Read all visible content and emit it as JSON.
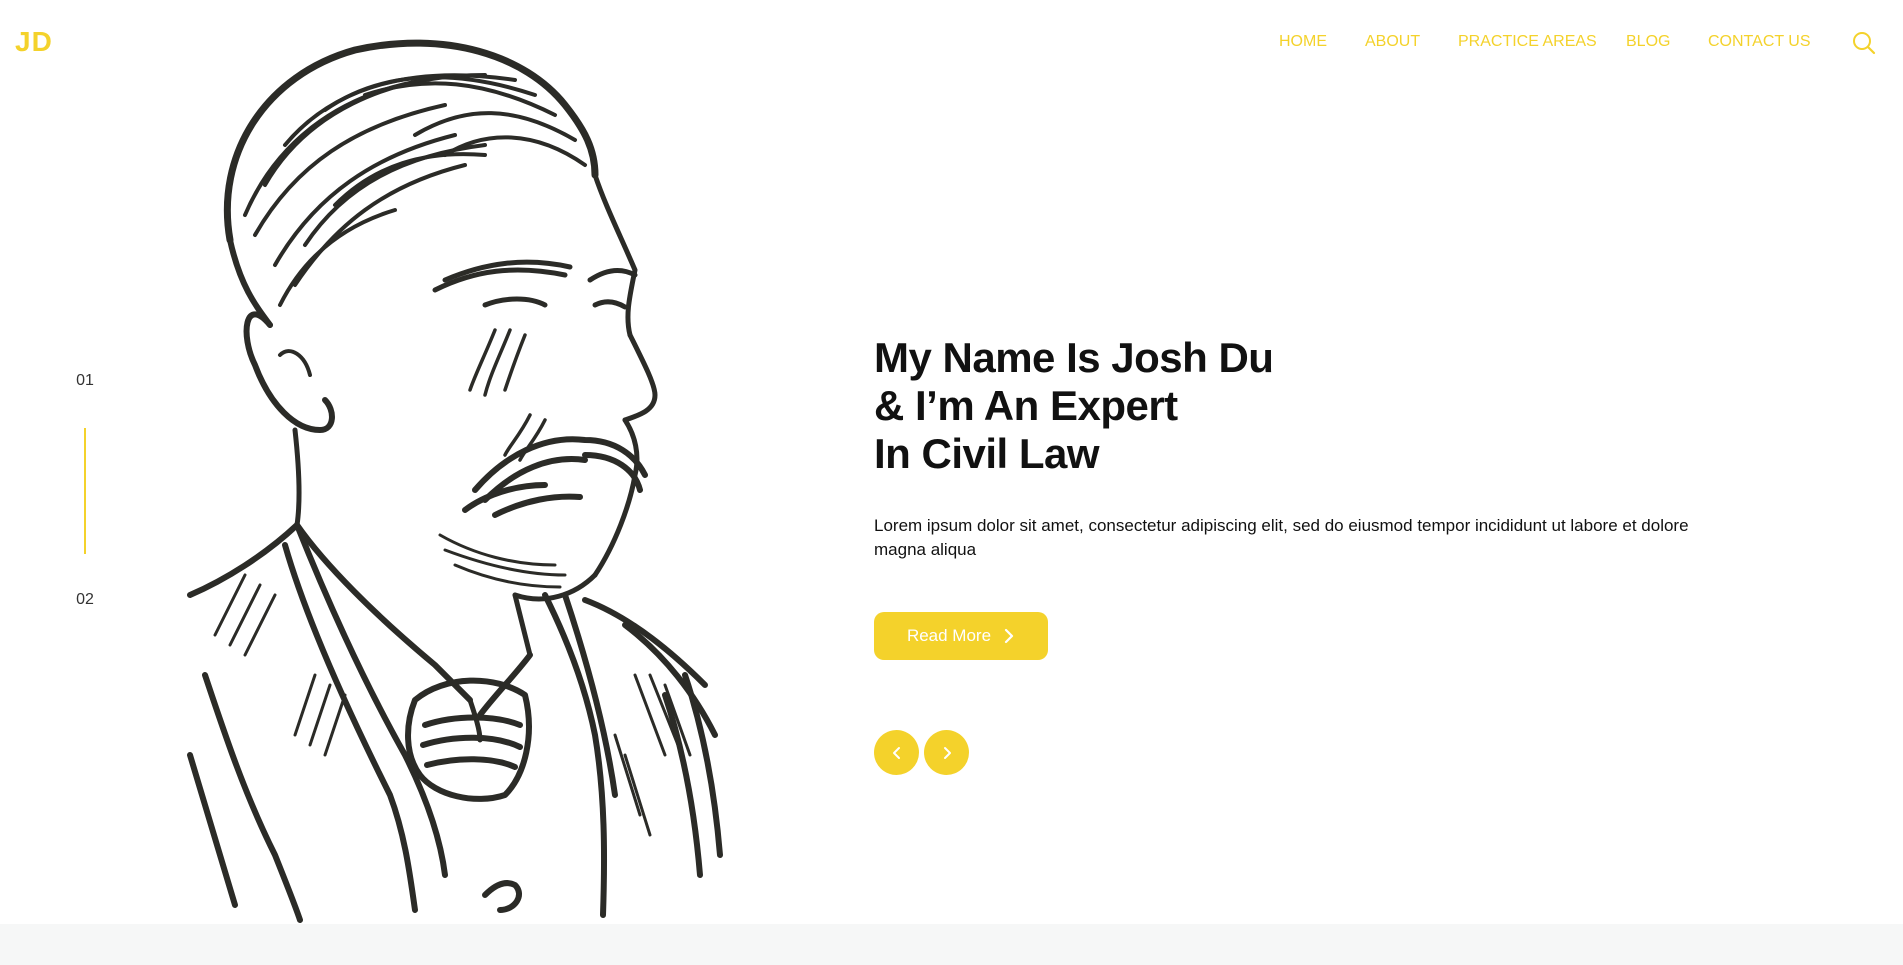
{
  "brand": {
    "logo_text": "JD",
    "accent_color": "#f4d22b"
  },
  "nav": {
    "items": [
      {
        "label": "HOME"
      },
      {
        "label": "ABOUT"
      },
      {
        "label": "PRACTICE AREAS"
      },
      {
        "label": "BLOG"
      },
      {
        "label": "CONTACT US"
      }
    ],
    "search_icon": "search-icon"
  },
  "slider": {
    "current": "01",
    "next": "02"
  },
  "hero": {
    "title_lines": [
      "My Name Is Josh Du",
      "& I’m An Expert",
      "In Civil Law"
    ],
    "description": "Lorem ipsum dolor sit amet, consectetur adipiscing elit, sed do eiusmod tempor incididunt ut labore et dolore magna aliqua",
    "cta_label": "Read More",
    "cta_icon": "chevron-right-icon",
    "prev_icon": "chevron-left-icon",
    "next_icon": "chevron-right-icon",
    "image": "line-drawing portrait of a man with moustache"
  }
}
